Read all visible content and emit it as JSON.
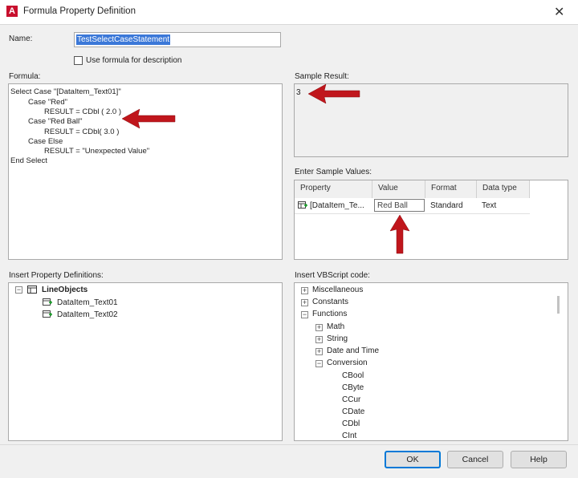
{
  "window": {
    "title": "Formula Property Definition",
    "app_icon": "A",
    "close_glyph": "✕"
  },
  "name_field": {
    "label": "Name:",
    "value": "TestSelectCaseStatement"
  },
  "use_formula_checkbox": {
    "label": "Use formula for description",
    "checked": false
  },
  "formula": {
    "label": "Formula:",
    "lines": [
      "Select Case \"[DataItem_Text01]\"",
      "Case \"Red\"",
      "RESULT = CDbl ( 2.0 )",
      "Case \"Red Ball\"",
      "RESULT = CDbl( 3.0 )",
      "Case Else",
      "RESULT = \"Unexpected Value\"",
      "End Select"
    ]
  },
  "sample_result": {
    "label": "Sample Result:",
    "value": "3"
  },
  "sample_values": {
    "label": "Enter Sample Values:",
    "columns": [
      "Property",
      "Value",
      "Format",
      "Data type"
    ],
    "row": {
      "property": "[DataItem_Te...",
      "value": "Red Ball",
      "format": "Standard",
      "data_type": "Text"
    }
  },
  "insert_property": {
    "label": "Insert Property Definitions:",
    "root": "LineObjects",
    "children": [
      "DataItem_Text01",
      "DataItem_Text02"
    ]
  },
  "insert_vbscript": {
    "label": "Insert VBScript code:",
    "items": [
      "Miscellaneous",
      "Constants",
      "Functions",
      "Math",
      "String",
      "Date and Time",
      "Conversion"
    ],
    "conversion_items": [
      "CBool",
      "CByte",
      "CCur",
      "CDate",
      "CDbl",
      "CInt"
    ]
  },
  "buttons": {
    "ok": "OK",
    "cancel": "Cancel",
    "help": "Help"
  },
  "tree_glyphs": {
    "expanded": "−",
    "collapsed": "+"
  },
  "colors": {
    "selection": "#3b78d8",
    "arrow": "#c0161c",
    "ok_border": "#0078d7",
    "app_icon": "#c8102e"
  }
}
